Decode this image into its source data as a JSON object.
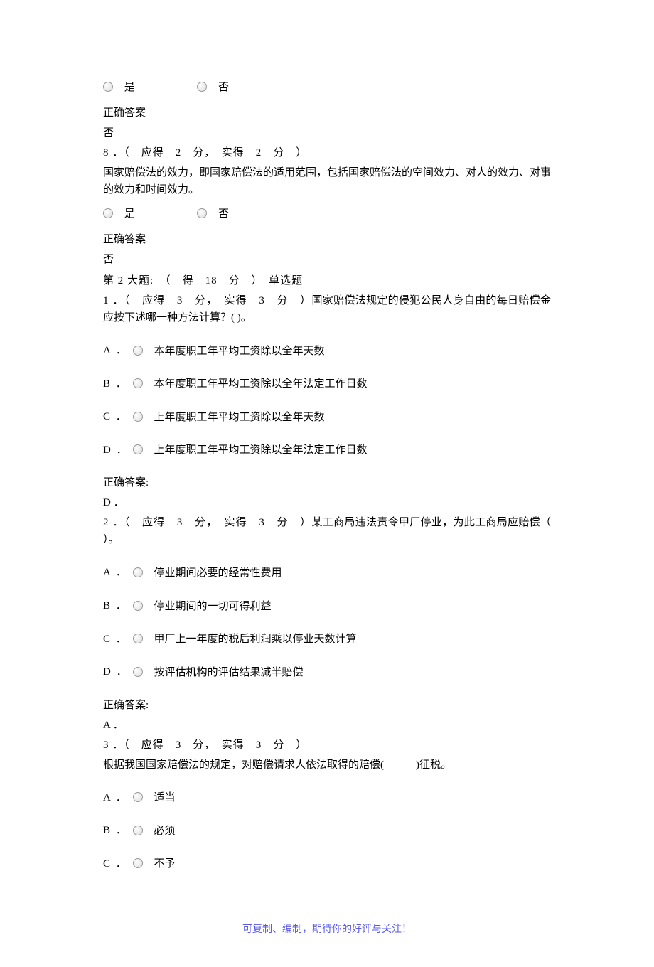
{
  "tf_labels": {
    "yes": "是",
    "no": "否"
  },
  "answer_label": "正确答案",
  "answer_label_colon": "正确答案:",
  "q7": {
    "answer": "否"
  },
  "q8": {
    "header": "8 ．（　应得　2　分，　实得　2　分　）",
    "text": "国家赔偿法的效力，即国家赔偿法的适用范围，包括国家赔偿法的空间效力、对人的效力、对事的效力和时间效力。",
    "answer": "否"
  },
  "section2": {
    "header": "第 2 大题:　（　得　18　分　）　单选题"
  },
  "mc1": {
    "header_pre": "1 ．（　应得　3　分，　实得　3　分　）",
    "header_post": "国家赔偿法规定的侵犯公民人身自由的每日赔偿金应按下述哪一种方法计算？( )。",
    "options": {
      "A": "本年度职工年平均工资除以全年天数",
      "B": "本年度职工年平均工资除以全年法定工作日数",
      "C": "上年度职工年平均工资除以全年天数",
      "D": "上年度职工年平均工资除以全年法定工作日数"
    },
    "answer": "D ．"
  },
  "mc2": {
    "header_pre": "2 ．（　应得　3　分，　实得　3　分　）",
    "header_post": "某工商局违法责令甲厂停业，为此工商局应赔偿（ ）。",
    "options": {
      "A": "停业期间必要的经常性费用",
      "B": "停业期间的一切可得利益",
      "C": "甲厂上一年度的税后利润乘以停业天数计算",
      "D": "按评估机构的评估结果减半赔偿"
    },
    "answer": "A ．"
  },
  "mc3": {
    "header": "3 ．（　应得　3　分，　实得　3　分　）",
    "text": "根据我国国家赔偿法的规定，对赔偿请求人依法取得的赔偿(　　　)征税。",
    "options": {
      "A": "适当",
      "B": "必须",
      "C": "不予"
    }
  },
  "letters": {
    "A": "A ．",
    "B": "B ．",
    "C": "C ．",
    "D": "D ．"
  },
  "footer": "可复制、编制，期待你的好评与关注！"
}
